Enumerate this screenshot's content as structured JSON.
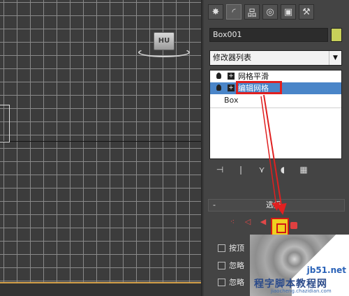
{
  "viewport": {
    "viewcube_label": "HU"
  },
  "command_panel": {
    "tabs": [
      {
        "icon": "create-star-icon",
        "glyph": "✸"
      },
      {
        "icon": "modify-curve-icon",
        "glyph": "◜"
      },
      {
        "icon": "hierarchy-icon",
        "glyph": "品"
      },
      {
        "icon": "motion-icon",
        "glyph": "◎"
      },
      {
        "icon": "display-monitor-icon",
        "glyph": "▣"
      },
      {
        "icon": "utilities-hammer-icon",
        "glyph": "⚒"
      }
    ],
    "object_name": "Box001",
    "object_color": "#c8d05a",
    "modifier_list": {
      "selected": "修改器列表"
    },
    "stack": [
      {
        "label": "网格平滑",
        "selected": false
      },
      {
        "label": "编辑网格",
        "selected": true
      },
      {
        "label": "Box",
        "selected": false
      }
    ],
    "stack_tools": [
      {
        "icon": "pin-stack-icon",
        "glyph": "⊣"
      },
      {
        "icon": "show-end-result-icon",
        "glyph": "❘"
      },
      {
        "icon": "make-unique-icon",
        "glyph": "⋎"
      },
      {
        "icon": "remove-modifier-icon",
        "glyph": "◖"
      },
      {
        "icon": "configure-modifier-sets-icon",
        "glyph": "▦"
      }
    ],
    "selection_rollout": {
      "collapse": "-",
      "title": "选择",
      "checkboxes": [
        {
          "label": "按顶"
        },
        {
          "label": "忽略"
        },
        {
          "label": "忽略"
        }
      ]
    }
  },
  "watermark": {
    "site": "jb51.net",
    "brand": "程字脚本教程网",
    "url": "jiaocheng.chazidian.com"
  },
  "colors": {
    "annotation_red": "#e02020",
    "selected_row": "#4a85c8",
    "element_button_yellow": "#f0d020"
  }
}
